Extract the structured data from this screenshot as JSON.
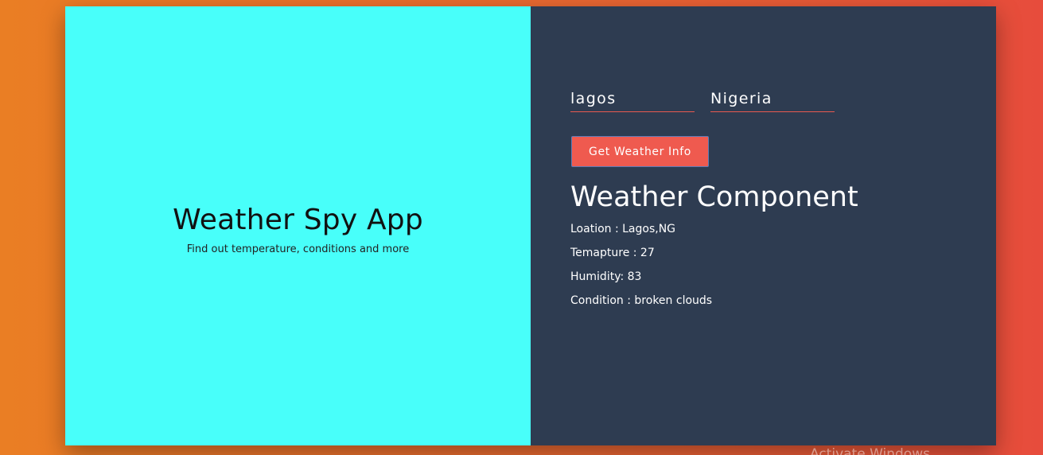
{
  "left_panel": {
    "title": "Weather Spy App",
    "subtitle": "Find out temperature, conditions and more"
  },
  "form": {
    "city_value": "lagos",
    "country_value": "Nigeria",
    "button_label": "Get Weather Info"
  },
  "weather": {
    "heading": "Weather Component",
    "location": "Loation : Lagos,NG",
    "temperature": "Temapture : 27",
    "humidity": "Humidity: 83",
    "condition": "Condition : broken clouds"
  },
  "watermark": "Activate Windows",
  "colors": {
    "left_panel_bg": "#48fffa",
    "right_panel_bg": "#2e3c51",
    "accent": "#ef5a4f",
    "page_gradient_start": "#ea7e24",
    "page_gradient_end": "#e74c3c"
  }
}
